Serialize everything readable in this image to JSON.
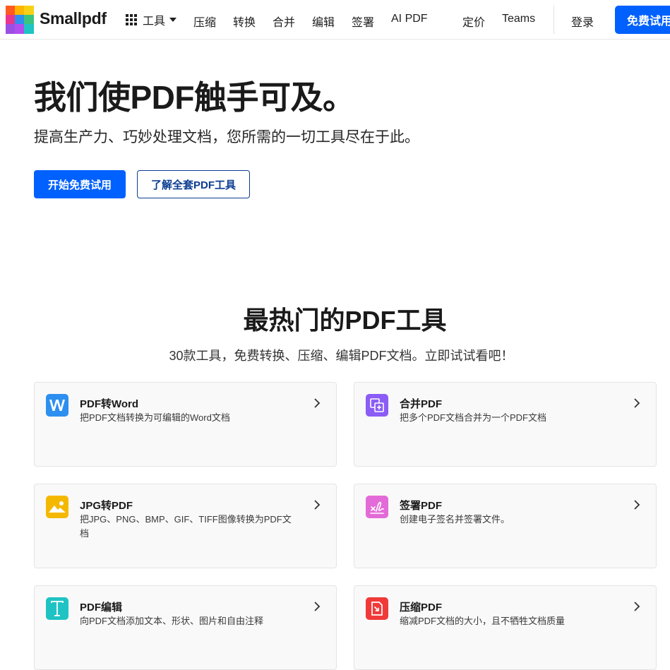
{
  "header": {
    "brand": "Smallpdf",
    "tools_label": "工具",
    "nav": [
      "压缩",
      "转换",
      "合并",
      "编辑",
      "签署",
      "AI PDF"
    ],
    "pricing": "定价",
    "teams": "Teams",
    "login": "登录",
    "signup": "免费试用"
  },
  "hero": {
    "title": "我们使PDF触手可及。",
    "subtitle": "提高生产力、巧妙处理文档，您所需的一切工具尽在于此。",
    "primary_cta": "开始免费试用",
    "secondary_cta": "了解全套PDF工具"
  },
  "section": {
    "title": "最热门的PDF工具",
    "subtitle": "30款工具，免费转换、压缩、编辑PDF文档。立即试试看吧！"
  },
  "tools": [
    {
      "title": "PDF转Word",
      "desc": "把PDF文档转换为可编辑的Word文档",
      "icon": "word-icon",
      "color": "#2d8ff0"
    },
    {
      "title": "合并PDF",
      "desc": "把多个PDF文档合并为一个PDF文档",
      "icon": "merge-icon",
      "color": "#8b5cf6"
    },
    {
      "title": "JPG转PDF",
      "desc": "把JPG、PNG、BMP、GIF、TIFF图像转换为PDF文档",
      "icon": "image-icon",
      "color": "#f5b800"
    },
    {
      "title": "签署PDF",
      "desc": "创建电子签名并签署文件。",
      "icon": "signature-icon",
      "color": "#e36bd8"
    },
    {
      "title": "PDF编辑",
      "desc": "向PDF文档添加文本、形状、图片和自由注释",
      "icon": "text-edit-icon",
      "color": "#1fc3c3"
    },
    {
      "title": "压缩PDF",
      "desc": "缩减PDF文档的大小，且不牺牲文档质量",
      "icon": "compress-icon",
      "color": "#f03a3a"
    }
  ],
  "colors": {
    "brand_blue": "#0061fe",
    "outline_navy": "#0b3d91"
  }
}
